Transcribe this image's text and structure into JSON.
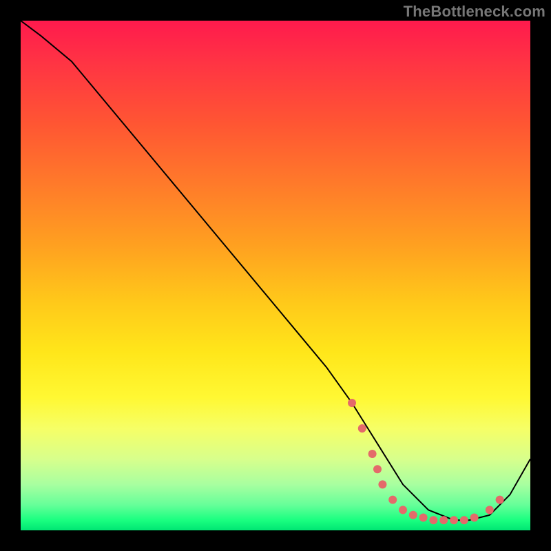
{
  "attribution": "TheBottleneck.com",
  "chart_data": {
    "type": "line",
    "title": "",
    "xlabel": "",
    "ylabel": "",
    "xlim": [
      0,
      100
    ],
    "ylim": [
      0,
      100
    ],
    "series": [
      {
        "name": "curve",
        "x": [
          0,
          4,
          10,
          20,
          30,
          40,
          50,
          55,
          60,
          65,
          70,
          75,
          80,
          85,
          88,
          92,
          96,
          100
        ],
        "y": [
          100,
          97,
          92,
          80,
          68,
          56,
          44,
          38,
          32,
          25,
          17,
          9,
          4,
          2,
          2,
          3,
          7,
          14
        ],
        "stroke": "#000000",
        "stroke_width": 2
      }
    ],
    "markers": {
      "name": "trough-markers",
      "color": "#e46a6a",
      "radius": 6,
      "points": [
        {
          "x": 65,
          "y": 25
        },
        {
          "x": 67,
          "y": 20
        },
        {
          "x": 69,
          "y": 15
        },
        {
          "x": 70,
          "y": 12
        },
        {
          "x": 71,
          "y": 9
        },
        {
          "x": 73,
          "y": 6
        },
        {
          "x": 75,
          "y": 4
        },
        {
          "x": 77,
          "y": 3
        },
        {
          "x": 79,
          "y": 2.5
        },
        {
          "x": 81,
          "y": 2
        },
        {
          "x": 83,
          "y": 2
        },
        {
          "x": 85,
          "y": 2
        },
        {
          "x": 87,
          "y": 2
        },
        {
          "x": 89,
          "y": 2.5
        },
        {
          "x": 92,
          "y": 4
        },
        {
          "x": 94,
          "y": 6
        }
      ]
    },
    "gradient_stops": [
      {
        "pos": 0,
        "color": "#ff1a4d"
      },
      {
        "pos": 20,
        "color": "#ff5533"
      },
      {
        "pos": 44,
        "color": "#ffa020"
      },
      {
        "pos": 65,
        "color": "#ffe61a"
      },
      {
        "pos": 86,
        "color": "#d8ff8c"
      },
      {
        "pos": 100,
        "color": "#00e673"
      }
    ]
  }
}
